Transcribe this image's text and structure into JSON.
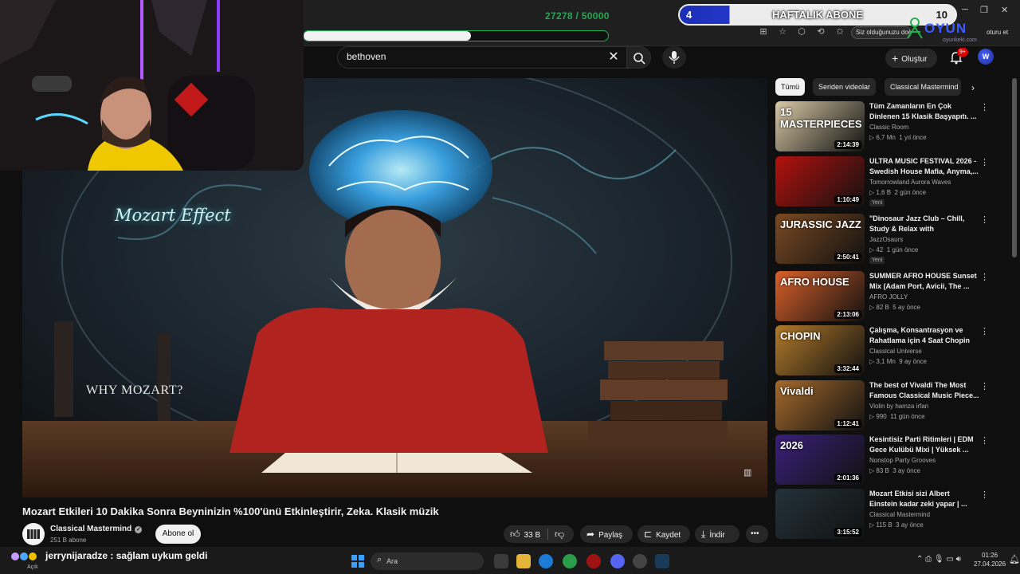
{
  "overlay": {
    "sub_counter_current": "27278",
    "sub_counter_sep": "/",
    "sub_counter_goal": "50000",
    "sub_progress": 0.55,
    "weekly_left": "4",
    "weekly_label": "HAFTALIK ABONE",
    "weekly_right": "10",
    "brand": "OYUN",
    "brand_sub": "oyunkeki.com",
    "logout": "oturu et"
  },
  "browser": {
    "translate_hint": "Siz olduğunuzu doğrulayın"
  },
  "youtube": {
    "search_value": "bethoven",
    "create_label": "Oluştur",
    "notification_count": "9+",
    "avatar_letter": "W"
  },
  "video": {
    "overlay_title": "Mozart Effect",
    "overlay_question": "WHY MOZART?",
    "title": "Mozart Etkileri 10 Dakika Sonra Beyninizin %100'ünü Etkinleştirir, Zeka. Klasik müzik",
    "channel": "Classical Mastermind",
    "subscribers": "251 B abone",
    "subscribe_label": "Abone ol",
    "likes": "33 B",
    "share_label": "Paylaş",
    "save_label": "Kaydet",
    "download_label": "İndir"
  },
  "sidebar": {
    "chips": [
      "Tümü",
      "Seriden videolar",
      "Classical Mastermind"
    ],
    "items": [
      {
        "title": "Tüm Zamanların En Çok Dinlenen 15 Klasik Başyapıtı. ...",
        "channel": "Classic Room",
        "views": "6,7 Mn",
        "age": "1 yıl önce",
        "duration": "2:14:39",
        "badge": "",
        "thumb_text": "15 MASTERPIECES",
        "thumb_color": "#d9c9a6"
      },
      {
        "title": "ULTRA MUSIC FESTIVAL 2026 - Swedish House Mafia, Anyma,...",
        "channel": "Tomorrowland Aurora Waves",
        "views": "1,6 B",
        "age": "2 gün önce",
        "duration": "1:10:49",
        "badge": "Yeni",
        "thumb_text": "",
        "thumb_color": "#b3110e"
      },
      {
        "title": "\"Dinosaur Jazz Club – Chill, Study & Relax with Prehistoric...",
        "channel": "JazzOsaurs",
        "views": "42",
        "age": "1 gün önce",
        "duration": "2:50:41",
        "badge": "Yeni",
        "thumb_text": "JURASSIC JAZZ",
        "thumb_color": "#7a4a22"
      },
      {
        "title": "SUMMER AFRO HOUSE Sunset Mix (Adam Port, Avicii, The ...",
        "channel": "AFRO JOLLY",
        "views": "82 B",
        "age": "5 ay önce",
        "duration": "2:13:06",
        "badge": "",
        "thumb_text": "AFRO HOUSE",
        "thumb_color": "#d8602a"
      },
      {
        "title": "Çalışma, Konsantrasyon ve Rahatlama için 4 Saat Chopin",
        "channel": "Classical Universe",
        "views": "3,1 Mn",
        "age": "9 ay önce",
        "duration": "3:32:44",
        "badge": "",
        "thumb_text": "CHOPIN",
        "thumb_color": "#b27a2a"
      },
      {
        "title": "The best of Vivaldi The Most Famous Classical Music Piece...",
        "channel": "Violin by hamza irfan",
        "views": "990",
        "age": "11 gün önce",
        "duration": "1:12:41",
        "badge": "",
        "thumb_text": "Vivaldi",
        "thumb_color": "#a56a2c"
      },
      {
        "title": "Kesintisiz Parti Ritimleri | EDM Gece Kulübü Mixi | Yüksek ...",
        "channel": "Nonstop Party Grooves",
        "views": "83 B",
        "age": "3 ay önce",
        "duration": "2:01:36",
        "badge": "",
        "thumb_text": "2026",
        "thumb_color": "#3a1f7a"
      },
      {
        "title": "Mozart Etkisi sizi Albert Einstein kadar zeki yapar | ...",
        "channel": "Classical Mastermind",
        "views": "115 B",
        "age": "3 ay önce",
        "duration": "3:15:52",
        "badge": "",
        "thumb_text": "",
        "thumb_color": "#23323a"
      }
    ]
  },
  "chat": {
    "icon_label": "Açık",
    "user": "jerrynijaradze",
    "sep": ":",
    "message": "sağlam uykum geldi"
  },
  "taskbar": {
    "search_placeholder": "Ara",
    "time": "01:26",
    "date": "27.04.2026"
  }
}
